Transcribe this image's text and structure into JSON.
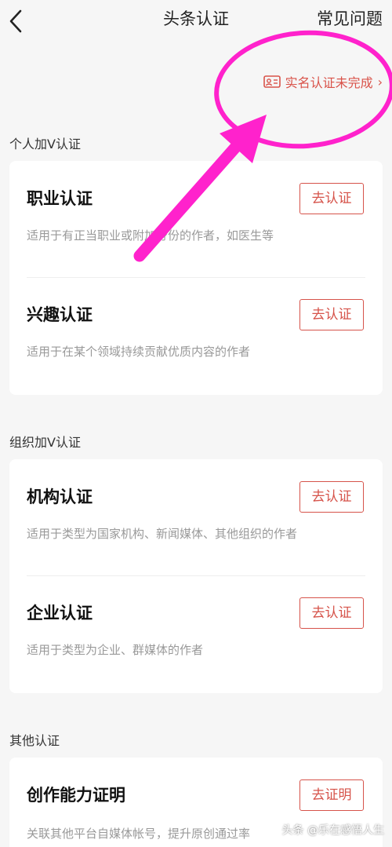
{
  "header": {
    "title": "头条认证",
    "help_label": "常见问题"
  },
  "realname": {
    "label": "实名认证未完成",
    "arrow": "›"
  },
  "sections": [
    {
      "title": "个人加V认证",
      "items": [
        {
          "title": "职业认证",
          "desc": "适用于有正当职业或附加身份的作者，如医生等",
          "button": "去认证"
        },
        {
          "title": "兴趣认证",
          "desc": "适用于在某个领域持续贡献优质内容的作者",
          "button": "去认证"
        }
      ]
    },
    {
      "title": "组织加V认证",
      "items": [
        {
          "title": "机构认证",
          "desc": "适用于类型为国家机构、新闻媒体、其他组织的作者",
          "button": "去认证"
        },
        {
          "title": "企业认证",
          "desc": "适用于类型为企业、群媒体的作者",
          "button": "去认证"
        }
      ]
    },
    {
      "title": "其他认证",
      "items": [
        {
          "title": "创作能力证明",
          "desc": "关联其他平台自媒体帐号，提升原创通过率",
          "button": "去证明"
        }
      ]
    }
  ],
  "watermark": "头条 @乐在感悟人生",
  "colors": {
    "accent": "#d6534a",
    "annotation": "#ff22cc",
    "background": "#f6f6f6"
  }
}
